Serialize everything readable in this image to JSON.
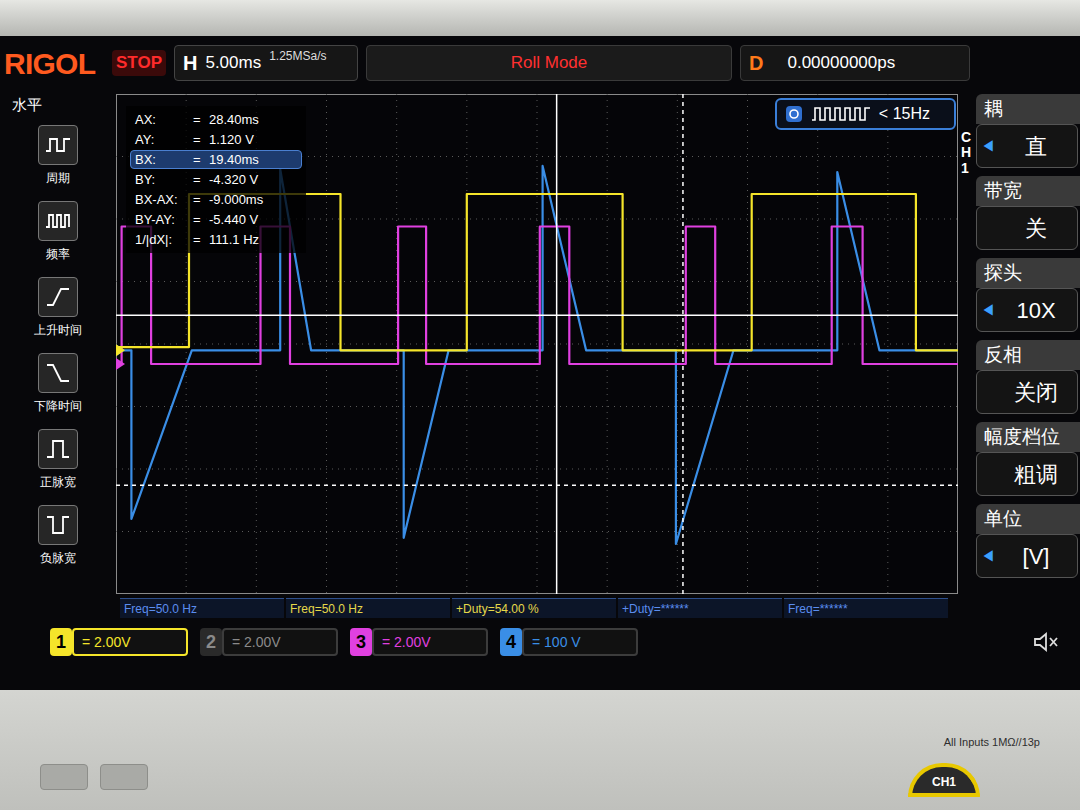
{
  "brand": "RIGOL",
  "run_state": "STOP",
  "horizontal": {
    "label": "H",
    "scale": "5.00ms",
    "sample_rate": "1.25MSa/s"
  },
  "mode": "Roll Mode",
  "delay": {
    "label": "D",
    "value": "0.00000000ps"
  },
  "trigger": {
    "text": "< 15Hz"
  },
  "left_menu": {
    "title": "水平",
    "items": [
      {
        "label": "周期",
        "kind": "period"
      },
      {
        "label": "频率",
        "kind": "frequency"
      },
      {
        "label": "上升时间",
        "kind": "rise"
      },
      {
        "label": "下降时间",
        "kind": "fall"
      },
      {
        "label": "正脉宽",
        "kind": "pwidth"
      },
      {
        "label": "负脉宽",
        "kind": "nwidth"
      }
    ]
  },
  "right_menu": {
    "channel": "CH1",
    "items": [
      {
        "label": "耦",
        "value": "直",
        "prefix": "◀"
      },
      {
        "label": "带宽",
        "value": "关"
      },
      {
        "label": "探头",
        "value": "10X",
        "prefix": "◀"
      },
      {
        "label": "反相",
        "value": "关闭"
      },
      {
        "label": "幅度档位",
        "value": "粗调"
      },
      {
        "label": "单位",
        "value": "[V]",
        "prefix": "◀"
      }
    ]
  },
  "readout": [
    {
      "label": "AX:",
      "sep": "=",
      "value": "28.40ms",
      "selected": false
    },
    {
      "label": "AY:",
      "sep": "=",
      "value": "1.120 V",
      "selected": false
    },
    {
      "label": "BX:",
      "sep": "=",
      "value": "19.40ms",
      "selected": true
    },
    {
      "label": "BY:",
      "sep": "=",
      "value": "-4.320 V",
      "selected": false
    },
    {
      "label": "BX-AX:",
      "sep": "=",
      "value": "-9.000ms",
      "selected": false
    },
    {
      "label": "BY-AY:",
      "sep": "=",
      "value": "-5.440 V",
      "selected": false
    },
    {
      "label": "1/|dX|:",
      "sep": "=",
      "value": "111.1 Hz",
      "selected": false
    }
  ],
  "measurements": [
    {
      "text": "Freq=50.0 Hz",
      "color": "#5b8def"
    },
    {
      "text": "Freq=50.0 Hz",
      "color": "#e6d84a"
    },
    {
      "text": "+Duty=54.00 %",
      "color": "#e6d84a"
    },
    {
      "text": "+Duty=******",
      "color": "#5b8def"
    },
    {
      "text": "Freq=******",
      "color": "#5b8def"
    }
  ],
  "channels": [
    {
      "number": "1",
      "scale": "= 2.00V",
      "on": true,
      "selected": true,
      "color": "#f5e52a",
      "trace": {
        "volts_per_div": 2,
        "offset_div": -0.1,
        "t": [
          -12,
          -6.8,
          -6.8,
          4.0,
          4.0,
          13.0,
          13.0,
          24.1,
          24.1,
          33.3,
          33.3,
          45.0,
          45.0,
          48
        ],
        "v": [
          0.1,
          0.1,
          5,
          5,
          0,
          0,
          5,
          5,
          0,
          0,
          5,
          5,
          0,
          0
        ]
      }
    },
    {
      "number": "2",
      "scale": "= 2.00V",
      "on": false,
      "selected": false,
      "color": "#5fb3e8"
    },
    {
      "number": "3",
      "scale": "= 2.00V",
      "on": true,
      "selected": false,
      "color": "#e040e0",
      "trace": {
        "volts_per_div": 2,
        "offset_div": -0.32,
        "t": [
          -12,
          -11.6,
          -11.6,
          -9.5,
          -9.5,
          -1.7,
          -1.7,
          0.4,
          0.4,
          8.1,
          8.1,
          10.1,
          10.1,
          18.2,
          18.2,
          20.3,
          20.3,
          28.6,
          28.6,
          30.7,
          30.7,
          39.0,
          39.0,
          41.2,
          41.2,
          48
        ],
        "v": [
          0,
          0,
          4.4,
          4.4,
          0,
          0,
          4.4,
          4.4,
          0,
          0,
          4.4,
          4.4,
          0,
          0,
          4.4,
          4.4,
          0,
          0,
          4.4,
          4.4,
          0,
          0,
          4.4,
          4.4,
          0,
          0
        ]
      }
    },
    {
      "number": "4",
      "scale": "= 100 V",
      "on": true,
      "selected": false,
      "color": "#3a8ee6",
      "trace": {
        "volts_per_div": 100,
        "offset_div": -0.1,
        "t": [
          -12,
          -10.9,
          -10.9,
          -6.6,
          -0.3,
          -0.3,
          1.9,
          8.5,
          8.5,
          11.7,
          18.4,
          18.4,
          21.5,
          27.9,
          27.9,
          32.0,
          39.4,
          39.4,
          42.4,
          48
        ],
        "v": [
          0,
          0,
          -270,
          0,
          0,
          290,
          0,
          0,
          -300,
          0,
          0,
          295,
          0,
          0,
          -310,
          0,
          0,
          285,
          0,
          0
        ]
      }
    }
  ],
  "bezel": {
    "inputs_label": "All Inputs 1MΩ//13p",
    "connector_label": "CH1"
  }
}
